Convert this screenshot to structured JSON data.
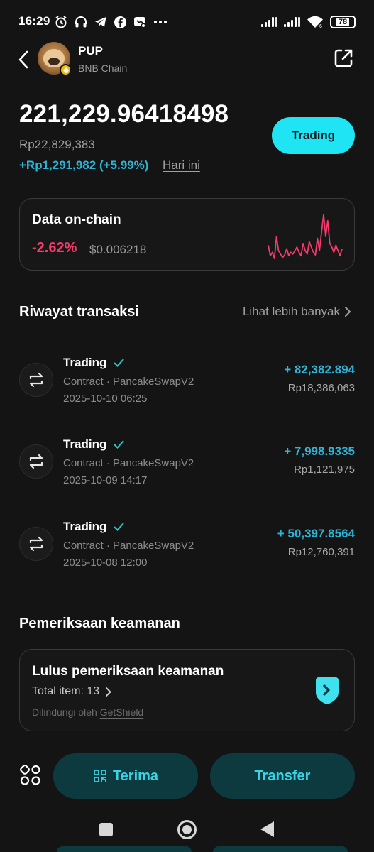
{
  "status_bar": {
    "time": "16:29",
    "battery": "78",
    "left_icons": [
      "alarm-icon",
      "headset-icon",
      "telegram-icon",
      "facebook-icon",
      "messenger-icon",
      "more-dots-icon"
    ],
    "right_icons": [
      "signal-icon",
      "signal-icon",
      "wifi-icon",
      "battery-icon"
    ]
  },
  "header": {
    "symbol": "PUP",
    "chain": "BNB Chain"
  },
  "balance": {
    "amount": "221,229.96418498",
    "fiat": "Rp22,829,383",
    "change": "+Rp1,291,982 (+5.99%)",
    "period": "Hari ini",
    "trading_label": "Trading"
  },
  "onchain": {
    "title": "Data on-chain",
    "change_pct": "-2.62%",
    "price": "$0.006218",
    "sparkline": [
      20,
      8,
      12,
      5,
      30,
      14,
      10,
      6,
      9,
      16,
      8,
      12,
      10,
      14,
      18,
      12,
      8,
      22,
      14,
      10,
      24,
      18,
      12,
      9,
      28,
      14,
      35,
      55,
      30,
      48,
      22,
      18,
      12,
      20,
      14,
      8,
      16
    ],
    "color": "#f23b6b"
  },
  "transactions_section": {
    "title": "Riwayat transaksi",
    "see_more": "Lihat lebih banyak"
  },
  "transactions": [
    {
      "type": "Trading",
      "contract": "Contract · PancakeSwapV2",
      "date": "2025-10-10 06:25",
      "amount": "+ 82,382.894",
      "fiat": "Rp18,386,063"
    },
    {
      "type": "Trading",
      "contract": "Contract · PancakeSwapV2",
      "date": "2025-10-09 14:17",
      "amount": "+ 7,998.9335",
      "fiat": "Rp1,121,975"
    },
    {
      "type": "Trading",
      "contract": "Contract · PancakeSwapV2",
      "date": "2025-10-08 12:00",
      "amount": "+ 50,397.8564",
      "fiat": "Rp12,760,391"
    }
  ],
  "security": {
    "section_title": "Pemeriksaan keamanan",
    "card_title": "Lulus pemeriksaan keamanan",
    "items": "Total item: 13",
    "protected_prefix": "Dilindungi oleh",
    "protected_by": "GetShield"
  },
  "actions": {
    "receive": "Terima",
    "transfer": "Transfer"
  },
  "colors": {
    "accent": "#1fe4f4",
    "positive": "#2fb3d6",
    "negative": "#f23b6b",
    "button_bg": "#0d3a3f"
  }
}
